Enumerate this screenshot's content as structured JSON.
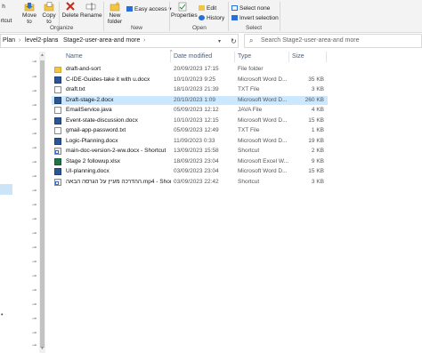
{
  "ribbon": {
    "clipboard": {
      "move_to": "Move to",
      "copy_to": "Copy to",
      "shortcut_partial": "rtcut",
      "cut_partial": "h"
    },
    "organize": {
      "label": "Organize",
      "delete": "Delete",
      "rename": "Rename"
    },
    "new": {
      "label": "New",
      "new_folder": "New folder",
      "easy_access": "Easy access"
    },
    "open": {
      "label": "Open",
      "properties": "Properties",
      "edit": "Edit",
      "history": "History"
    },
    "select": {
      "label": "Select",
      "select_none": "Select none",
      "invert_selection": "Invert selection"
    }
  },
  "address": {
    "crumbs": [
      "Plan",
      "level2-plans",
      "Stage2-user-area-and more"
    ],
    "search_placeholder": "Search Stage2-user-area-and more"
  },
  "columns": {
    "name": "Name",
    "date": "Date modified",
    "type": "Type",
    "size": "Size"
  },
  "files": [
    {
      "name": "draft-and-sort",
      "date": "20/09/2023 17:15",
      "type": "File folder",
      "size": "",
      "icon": "folder",
      "selected": false
    },
    {
      "name": "C-IDE-Guides-take it with u.docx",
      "date": "10/10/2023 9:25",
      "type": "Microsoft Word D...",
      "size": "35 KB",
      "icon": "word",
      "selected": false
    },
    {
      "name": "draft.txt",
      "date": "18/10/2023 21:39",
      "type": "TXT File",
      "size": "3 KB",
      "icon": "txt",
      "selected": false
    },
    {
      "name": "Draft-stage-2.docx",
      "date": "20/10/2023 1:09",
      "type": "Microsoft Word D...",
      "size": "260 KB",
      "icon": "word",
      "selected": true
    },
    {
      "name": "EmailService.java",
      "date": "05/09/2023 12:12",
      "type": "JAVA File",
      "size": "4 KB",
      "icon": "java",
      "selected": false
    },
    {
      "name": "Event-state-discussion.docx",
      "date": "10/10/2023 12:15",
      "type": "Microsoft Word D...",
      "size": "15 KB",
      "icon": "word",
      "selected": false
    },
    {
      "name": "gmail-app-password.txt",
      "date": "05/09/2023 12:49",
      "type": "TXT File",
      "size": "1 KB",
      "icon": "txt",
      "selected": false
    },
    {
      "name": "Logic-Planning.docx",
      "date": "11/09/2023 0:33",
      "type": "Microsoft Word D...",
      "size": "19 KB",
      "icon": "word",
      "selected": false
    },
    {
      "name": "main-doc-version-2-ww.docx - Shortcut",
      "date": "13/09/2023 15:58",
      "type": "Shortcut",
      "size": "2 KB",
      "icon": "shortcut",
      "selected": false
    },
    {
      "name": "Stage 2 followup.xlsx",
      "date": "18/09/2023 23:04",
      "type": "Microsoft Excel W...",
      "size": "9 KB",
      "icon": "excel",
      "selected": false
    },
    {
      "name": "UI-planning.docx",
      "date": "03/09/2023 23:04",
      "type": "Microsoft Word D...",
      "size": "15 KB",
      "icon": "word",
      "selected": false
    },
    {
      "name": "ההדרכה מעיין על הגרסה הבאה.mp4 - Shor...",
      "date": "03/09/2023 22:42",
      "type": "Shortcut",
      "size": "3 KB",
      "icon": "shortcut",
      "selected": false
    }
  ],
  "colors": {
    "selected_row": "#cce8ff",
    "nav_selected": "#cce4f7",
    "delete_red": "#c42b1c",
    "accent_blue": "#2b6fd6"
  }
}
